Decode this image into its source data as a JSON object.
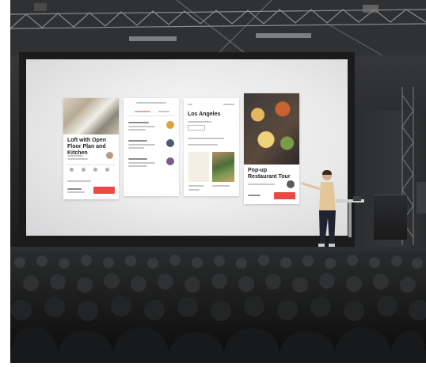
{
  "scene": {
    "description_type": "photo",
    "colors": {
      "screen": "#ececec",
      "accent_red": "#e94a45",
      "venue_dark": "#1d1e20"
    }
  },
  "slide": {
    "cards": [
      {
        "title": "Loft with Open Floor Plan and Kitchen"
      },
      {
        "title": ""
      },
      {
        "title": "Los Angeles"
      },
      {
        "title": "Pop-up Restaurant Tour"
      }
    ]
  }
}
